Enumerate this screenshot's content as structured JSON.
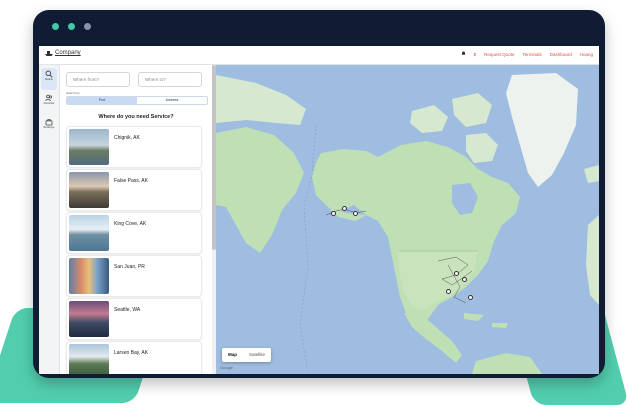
{
  "brand": {
    "name": "Company"
  },
  "nav": {
    "user_label": "$",
    "links": [
      "Request Quote",
      "Terminals",
      "Dashboard",
      "Hoang"
    ]
  },
  "rail": [
    "Search",
    "Favorites",
    "Bookings"
  ],
  "search": {
    "from_placeholder": "Where from?",
    "to_placeholder": "Where to?",
    "search_by_label": "Search by:",
    "options": [
      "Port",
      "Address"
    ],
    "selected": "Port"
  },
  "service": {
    "heading": "Where do you need Service?",
    "locations": [
      "Chignik, AK",
      "False Pass, AK",
      "King Cove, AK",
      "San Juan, PR",
      "Seattle, WA",
      "Larsen Bay, AK"
    ]
  },
  "map": {
    "type_options": [
      "Map",
      "Satellite"
    ],
    "selected_type": "Map",
    "attribution": "Google"
  },
  "colors": {
    "accent": "#e0503c",
    "frame": "#0f1c33",
    "glow": "#3fc9a6",
    "water": "#9fbde0",
    "land": "#bfe0b4"
  }
}
